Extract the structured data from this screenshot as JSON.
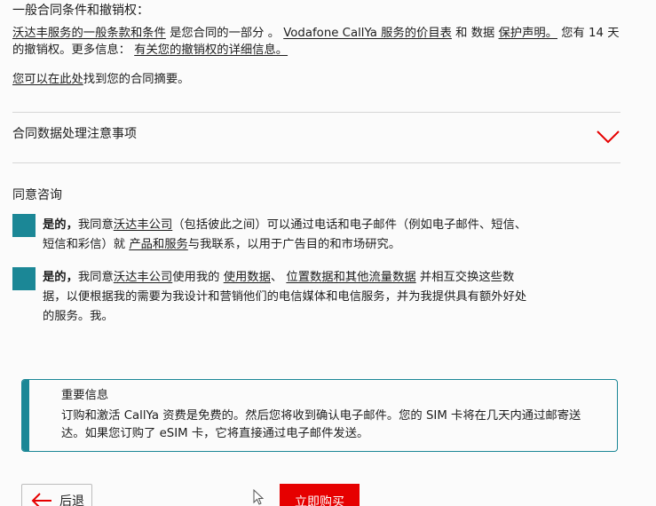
{
  "colors": {
    "accent": "#1b8796",
    "brand_red": "#e60000",
    "divider": "#d6d6d6"
  },
  "terms": {
    "heading": "一般合同条件和撤销权：",
    "link_general_terms": "沃达丰服务的一般条款和条件",
    "text_part_of_contract": " 是您合同的一部分 。 ",
    "link_price_list": "Vodafone CallYa 服务的价目表",
    "text_and_data": " 和 数据 ",
    "link_privacy": "保护声明。",
    "text_withdrawal": " 您有 14 天的撤销权。更多信息：  ",
    "link_withdrawal_details": "有关您的撤销权的详细信息。",
    "summary_link": "您可以在此处",
    "summary_text": "找到您的合同摘要。"
  },
  "accordion": {
    "title": "合同数据处理注意事项",
    "icon": "chevron-down-icon"
  },
  "consent": {
    "title": "同意咨询",
    "item1": {
      "yes": "是的，",
      "t1": "我同意",
      "link1": "沃达丰公司",
      "t2": "（包括彼此之间）可以通过电话和电子邮件（例如电子邮件、短信、短信和彩信）就 ",
      "link2": "产品和服务",
      "t3": "与我联系，以用于广告目的和市场研究。"
    },
    "item2": {
      "yes": "是的，",
      "t1": "我同意",
      "link1": "沃达丰公司",
      "t2": "使用我的 ",
      "link2": "使用数据",
      "t3": "、 ",
      "link3": "位置数据和其他流量数据",
      "t4": " 并相互交换这些数据，以便根据我的需要为我设计和营销他们的电信媒体和电信服务，并为我提供具有额外好处的服务。我。"
    }
  },
  "info": {
    "title": "重要信息",
    "body": "订购和激活 CallYa 资费是免费的。然后您将收到确认电子邮件。您的 SIM 卡将在几天内通过邮寄送达。如果您订购了 eSIM 卡，它将直接通过电子邮件发送。"
  },
  "footer": {
    "back_label": "后退",
    "buy_label": "立即购买"
  }
}
